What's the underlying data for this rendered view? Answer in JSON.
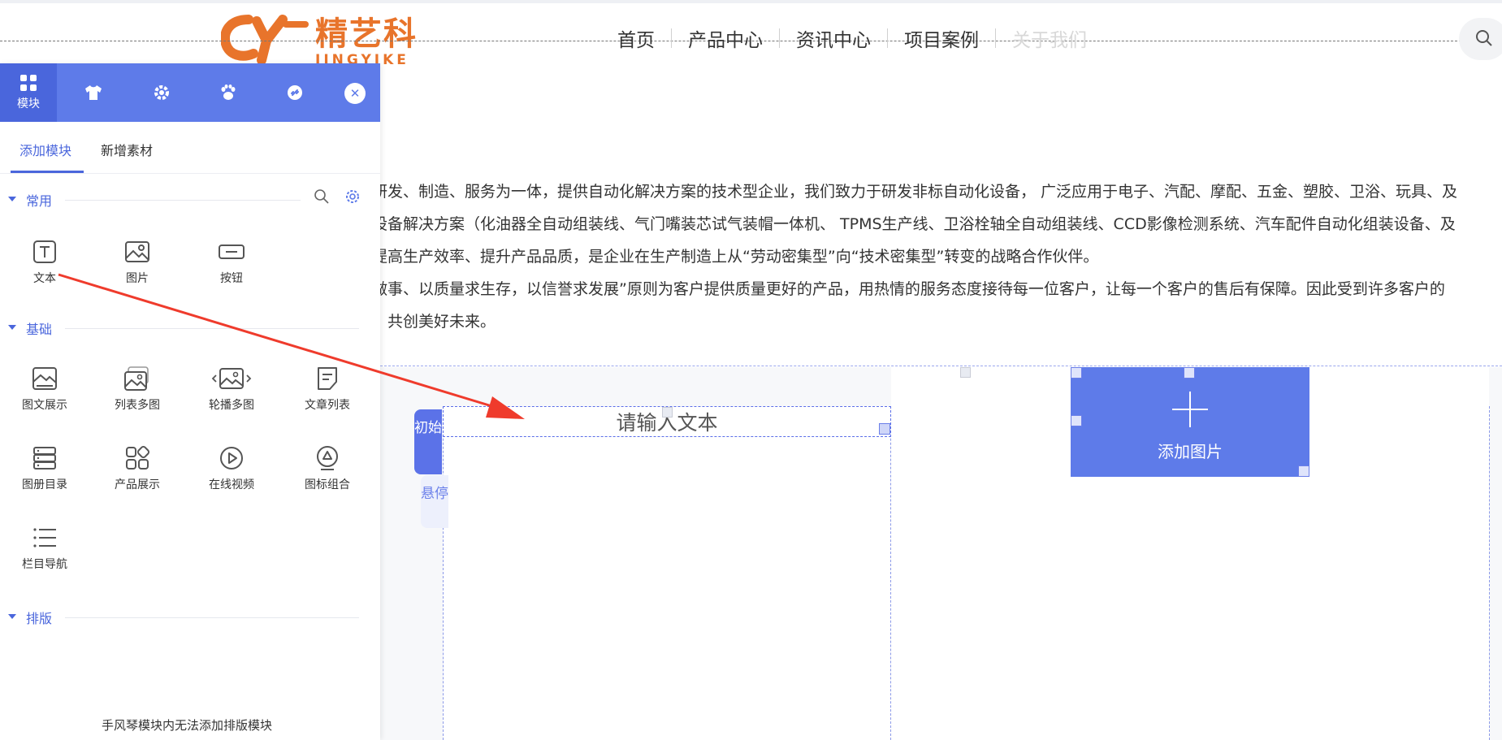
{
  "header": {
    "logo_cn": "精艺科",
    "logo_en": "JINGYIKE",
    "nav": [
      "首页",
      "产品中心",
      "资讯中心",
      "项目案例",
      "关于我们"
    ],
    "search_icon": "search-icon"
  },
  "intro_lines": [
    "研发、制造、服务为一体，提供自动化解决方案的技术型企业，我们致力于研发非标自动化设备， 广泛应用于电子、汽配、摩配、五金、塑胶、卫浴、玩具、及",
    "设备解决方案（化油器全自动组装线、气门嘴装芯试气装帽一体机、 TPMS生产线、卫浴栓轴全自动组装线、CCD影像检测系统、汽车配件自动化组装设备、及",
    "提高生产效率、提升产品品质，是企业在生产制造上从“劳动密集型”向“技术密集型”转变的战略合作伙伴。",
    "做事、以质量求生存，以信誉求发展”原则为客户提供质量更好的产品，用热情的服务态度接待每一位客户，让每一个客户的售后有保障。因此受到许多客户的",
    "，共创美好未来。"
  ],
  "canvas": {
    "text_placeholder": "请输入文本",
    "state_initial": "初始",
    "state_hover": "悬停",
    "add_image": "添加图片"
  },
  "panel": {
    "tabs": [
      {
        "icon": "grid-icon",
        "label": "模块"
      },
      {
        "icon": "shirt-icon",
        "label": ""
      },
      {
        "icon": "gear-icon",
        "label": ""
      },
      {
        "icon": "paw-icon",
        "label": ""
      },
      {
        "icon": "link-icon",
        "label": ""
      }
    ],
    "close_icon": "close-icon",
    "subtabs": [
      "添加模块",
      "新增素材"
    ],
    "groups": {
      "common": {
        "label": "常用",
        "items": [
          "文本",
          "图片",
          "按钮"
        ]
      },
      "basic": {
        "label": "基础",
        "items": [
          "图文展示",
          "列表多图",
          "轮播多图",
          "文章列表",
          "图册目录",
          "产品展示",
          "在线视频",
          "图标组合",
          "栏目导航"
        ]
      },
      "layout": {
        "label": "排版"
      }
    },
    "footer": "手风琴模块内无法添加排版模块"
  },
  "colors": {
    "accent": "#5e7be9",
    "accent_dark": "#4a66dc",
    "logo": "#e8742b",
    "annotation_arrow": "#ef3b2c"
  }
}
